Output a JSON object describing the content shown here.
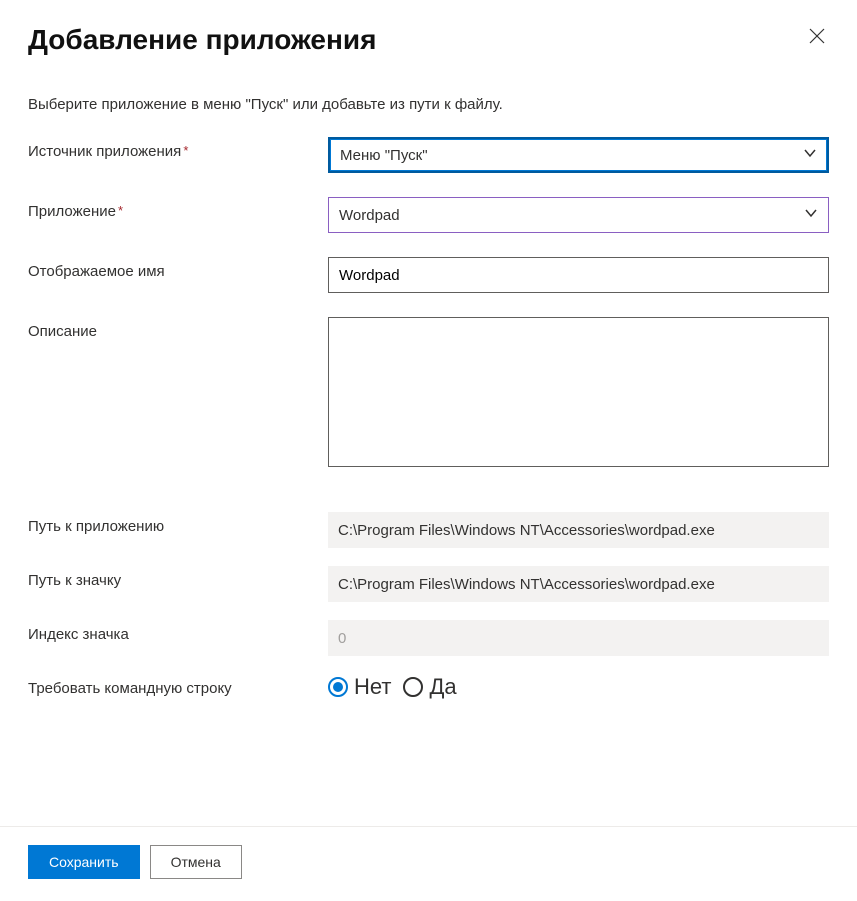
{
  "header": {
    "title": "Добавление приложения"
  },
  "subtitle": "Выберите приложение в меню \"Пуск\" или добавьте из пути к файлу.",
  "fields": {
    "app_source": {
      "label": "Источник приложения",
      "value": "Меню \"Пуск\""
    },
    "application": {
      "label": "Приложение",
      "value": "Wordpad"
    },
    "display_name": {
      "label": "Отображаемое имя",
      "value": "Wordpad"
    },
    "description": {
      "label": "Описание",
      "value": ""
    },
    "app_path": {
      "label": "Путь к приложению",
      "value": "C:\\Program Files\\Windows NT\\Accessories\\wordpad.exe"
    },
    "icon_path": {
      "label": "Путь к значку",
      "value": "C:\\Program Files\\Windows NT\\Accessories\\wordpad.exe"
    },
    "icon_index": {
      "label": "Индекс значка",
      "value": "0"
    },
    "require_cmdline": {
      "label": "Требовать командную строку",
      "option_no": "Нет",
      "option_yes": "Да"
    }
  },
  "footer": {
    "save": "Сохранить",
    "cancel": "Отмена"
  }
}
